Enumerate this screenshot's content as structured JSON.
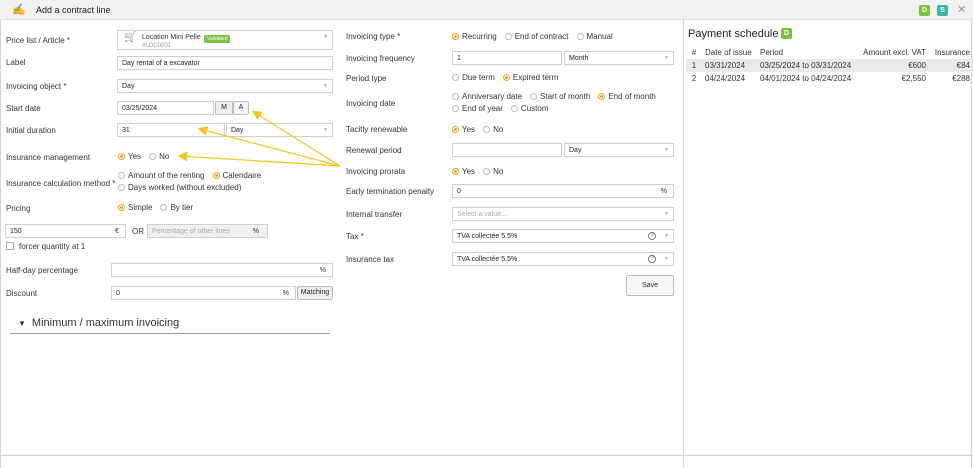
{
  "dialog": {
    "title": "Add a contract line",
    "badges": [
      "D",
      "S"
    ]
  },
  "left": {
    "price_list_label": "Price list / Article *",
    "article_name": "Location Mini Pelle",
    "article_badge": "Validated",
    "article_code": "#LOC0001",
    "label_label": "Label",
    "label_value": "Day rental of a excavator",
    "invoicing_object_label": "Invoicing object *",
    "invoicing_object_value": "Day",
    "start_date_label": "Start date",
    "start_date_value": "03/25/2024",
    "start_date_btn_m": "M",
    "start_date_btn_a": "A",
    "initial_duration_label": "Initial duration",
    "initial_duration_value": "31",
    "initial_duration_unit": "Day",
    "insurance_mgmt_label": "Insurance management",
    "insurance_mgmt_yes": "Yes",
    "insurance_mgmt_no": "No",
    "insurance_calc_label": "Insurance calculation method *",
    "insurance_calc_opt1": "Amount of the renting",
    "insurance_calc_opt2": "Calendaire",
    "insurance_calc_opt3": "Days worked (without excluded)",
    "pricing_label": "Pricing",
    "pricing_simple": "Simple",
    "pricing_tier": "By tier",
    "price_value": "150",
    "price_currency": "€",
    "or_text": "OR",
    "percentage_placeholder": "Percentage of other lines",
    "percent_sign": "%",
    "force_qty_label": "forcer quantity at 1",
    "half_day_label": "Half-day percentage",
    "discount_label": "Discount",
    "discount_value": "0",
    "matching_btn": "Matching",
    "min_max_section": "Minimum / maximum invoicing"
  },
  "middle": {
    "invoicing_type_label": "Invoicing type *",
    "invoicing_type_opts": [
      "Recurring",
      "End of contract",
      "Manual"
    ],
    "invoicing_freq_label": "Invoicing frequency",
    "invoicing_freq_value": "1",
    "invoicing_freq_unit": "Month",
    "period_type_label": "Period type",
    "period_type_opts": [
      "Due term",
      "Expired term"
    ],
    "invoicing_date_label": "Invoicing date",
    "invoicing_date_opts": [
      "Anniversary date",
      "Start of month",
      "End of month",
      "End of year",
      "Custom"
    ],
    "tacitly_label": "Tacitly renewable",
    "tacitly_yes": "Yes",
    "tacitly_no": "No",
    "renewal_label": "Renewal period",
    "renewal_unit": "Day",
    "prorata_label": "Invoicing prorata",
    "prorata_yes": "Yes",
    "prorata_no": "No",
    "early_term_label": "Early termination penalty",
    "early_term_value": "0",
    "early_term_unit": "%",
    "internal_transfer_label": "Internal transfer",
    "internal_transfer_placeholder": "Select a value...",
    "tax_label": "Tax *",
    "tax_value": "TVA collectée 5.5%",
    "insurance_tax_label": "Insurance tax",
    "insurance_tax_value": "TVA collectée 5.5%",
    "save_btn": "Save"
  },
  "schedule": {
    "title": "Payment schedule",
    "badge": "D",
    "headers": [
      "#",
      "Date of issue",
      "Period",
      "Amount excl. VAT",
      "Insurance"
    ],
    "rows": [
      [
        "1",
        "03/31/2024",
        "03/25/2024 to 03/31/2024",
        "€600",
        "€84"
      ],
      [
        "2",
        "04/24/2024",
        "04/01/2024 to 04/24/2024",
        "€2,550",
        "€288"
      ]
    ]
  },
  "colors": {
    "accent": "#f0a020",
    "badge_green": "#7cc242",
    "badge_teal": "#41b5a5",
    "arrow": "#f5c518"
  }
}
